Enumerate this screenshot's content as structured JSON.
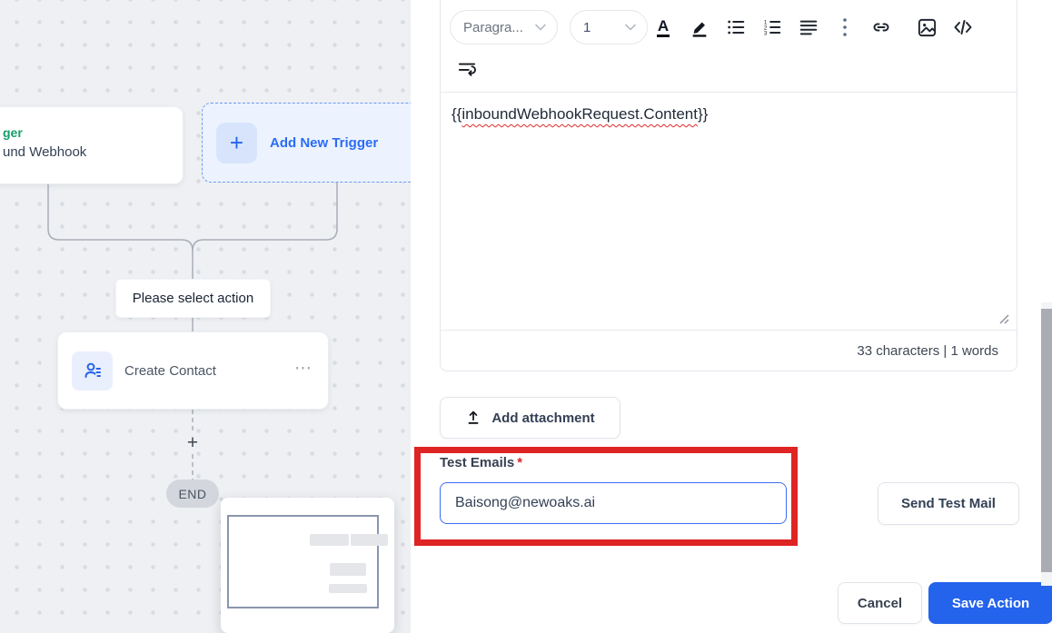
{
  "canvas": {
    "trigger_card": {
      "title": "ger",
      "subtitle": "und Webhook"
    },
    "add_trigger_button": {
      "plus_glyph": "+",
      "label": "Add New Trigger"
    },
    "select_action_tooltip": "Please select action",
    "action_card": {
      "label": "Create Contact",
      "menu_glyph": "⋯"
    },
    "plus_connector_glyph": "+",
    "end_badge": "END"
  },
  "editor": {
    "toolbar": {
      "block_format": "Paragra...",
      "font_size": "1",
      "text_color_glyph": "A",
      "icon_names": [
        "text-color",
        "highlighter",
        "bullet-list",
        "ordered-list",
        "align-justify",
        "more-options",
        "link",
        "image",
        "code-view",
        "text-wrap"
      ]
    },
    "body": {
      "open_braces": "{{",
      "token": "inboundWebhookRequest.Content",
      "close_braces": "}}"
    },
    "status_bar": "33 characters | 1 words"
  },
  "test_emails": {
    "label": "Test Emails",
    "required_mark": "*",
    "value": "Baisong@newoaks.ai"
  },
  "actions": {
    "add_attachment": "Add attachment",
    "send_test_mail": "Send Test Mail",
    "cancel": "Cancel",
    "save": "Save Action"
  },
  "colors": {
    "accent_blue": "#2563eb",
    "trigger_green": "#149e69",
    "annotation_red": "#df2424",
    "squiggle_red": "#e02b2b"
  }
}
